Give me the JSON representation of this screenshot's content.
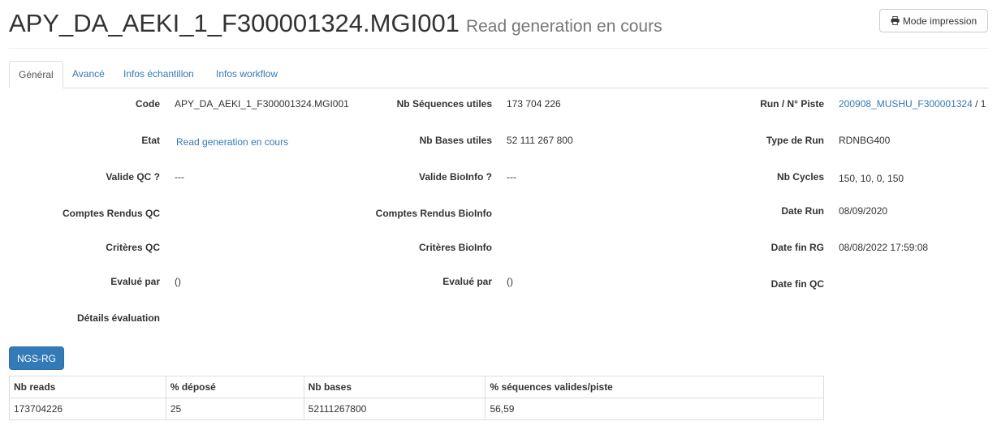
{
  "header": {
    "title": "APY_DA_AEKI_1_F300001324.MGI001",
    "subtitle": "Read generation en cours",
    "print_button": "Mode impression",
    "print_icon": "printer-icon"
  },
  "tabs": [
    "Général",
    "Avancé",
    "Infos échantillon",
    "Infos workflow"
  ],
  "active_tab": "Général",
  "col1": {
    "code_label": "Code",
    "code_value": "APY_DA_AEKI_1_F300001324.MGI001",
    "etat_label": "Etat",
    "etat_value": "Read generation en cours",
    "valide_qc_label": "Valide QC ?",
    "valide_qc_value": "---",
    "comptes_rendus_label": "Comptes Rendus QC",
    "criteres_label": "Critères QC",
    "evalue_par_label": "Evalué par",
    "evalue_par_value": "()",
    "details_label": "Détails évaluation"
  },
  "col2": {
    "nb_seq_label": "Nb Séquences utiles",
    "nb_seq_value": "173 704 226",
    "nb_bases_label": "Nb Bases utiles",
    "nb_bases_value": "52 111 267 800",
    "valide_bioinfo_label": "Valide BioInfo ?",
    "valide_bioinfo_value": "---",
    "comptes_rendus_label": "Comptes Rendus BioInfo",
    "criteres_label": "Critères BioInfo",
    "evalue_par_label": "Evalué par",
    "evalue_par_value": "()"
  },
  "col3": {
    "run_label": "Run / N° Piste",
    "run_link": "200908_MUSHU_F300001324",
    "run_suffix": " / 1",
    "type_run_label": "Type de Run",
    "type_run_value": "RDNBG400",
    "nb_cycles_label": "Nb Cycles",
    "nb_cycles_value": "150, 10, 0, 150",
    "date_run_label": "Date Run",
    "date_run_value": "08/09/2020",
    "date_fin_rg_label": "Date fin RG",
    "date_fin_rg_value": "08/08/2022 17:59:08",
    "date_fin_qc_label": "Date fin QC"
  },
  "ngs_button": "NGS-RG",
  "table": {
    "headers": [
      "Nb reads",
      "% déposé",
      "Nb bases",
      "% séquences valides/piste"
    ],
    "rows": [
      [
        "173704226",
        "25",
        "52111267800",
        "56,59"
      ]
    ]
  }
}
